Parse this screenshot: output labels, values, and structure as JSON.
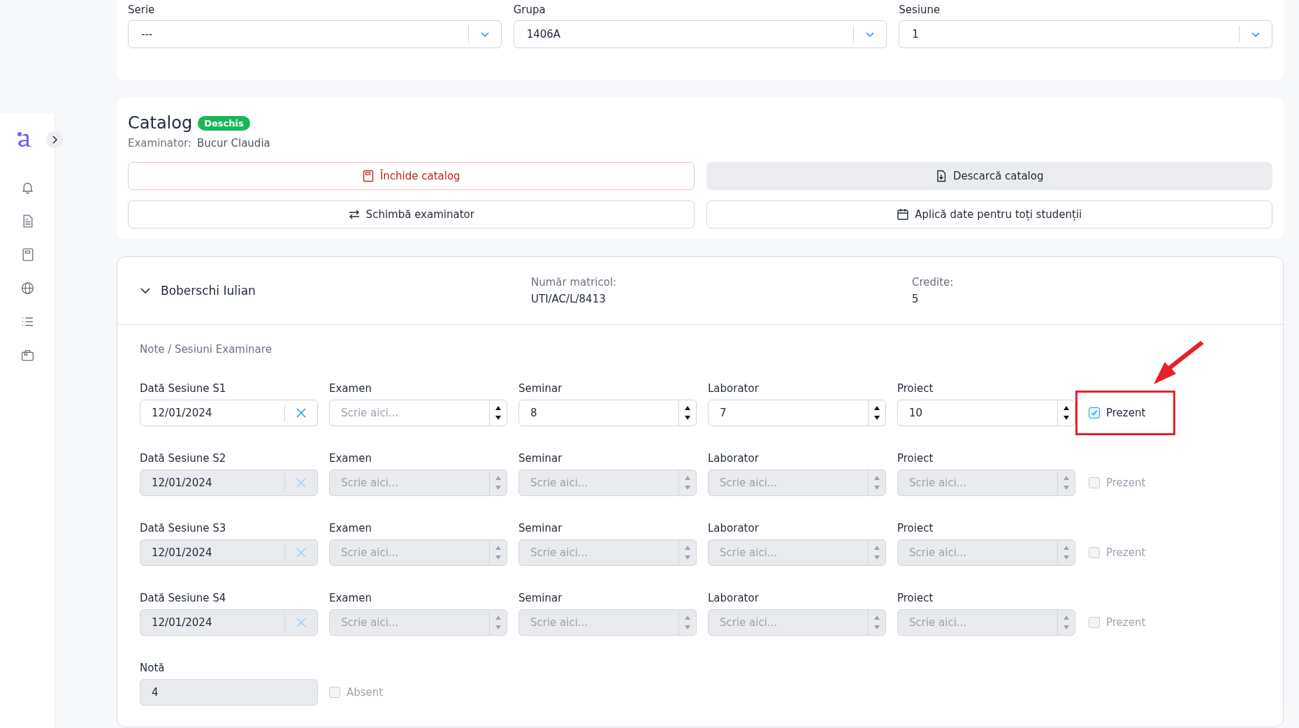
{
  "filters": [
    {
      "label": "Serie",
      "value": "---"
    },
    {
      "label": "Grupa",
      "value": "1406A"
    },
    {
      "label": "Sesiune",
      "value": "1"
    }
  ],
  "catalog": {
    "title": "Catalog",
    "status": "Deschis",
    "examiner_label": "Examinator:",
    "examiner": "Bucur Claudia",
    "buttons": [
      {
        "label": "Închide catalog",
        "kind": "danger"
      },
      {
        "label": "Descarcă catalog",
        "kind": "filled"
      },
      {
        "label": "Schimbă examinator",
        "kind": "outline"
      },
      {
        "label": "Aplică date pentru toți studenții",
        "kind": "outline"
      }
    ]
  },
  "student": {
    "name": "Boberschi Iulian",
    "expanded": true,
    "fields": [
      {
        "label": "Număr matricol:",
        "value": "UTI/AC/L/8413"
      },
      {
        "label": "Credite:",
        "value": "5"
      }
    ],
    "section_title": "Note / Sesiuni Examinare",
    "sessions": [
      {
        "date_label": "Dată Sesiune S1",
        "date": "12/01/2024",
        "disabled": false,
        "highlighted": true,
        "grades": [
          {
            "label": "Examen",
            "placeholder": "Scrie aici..."
          },
          {
            "label": "Seminar",
            "value": "8"
          },
          {
            "label": "Laborator",
            "value": "7"
          },
          {
            "label": "Proiect",
            "value": "10"
          }
        ],
        "present": {
          "label": "Prezent",
          "checked": true
        }
      },
      {
        "date_label": "Dată Sesiune S2",
        "date": "12/01/2024",
        "disabled": true,
        "highlighted": false,
        "grades": [
          {
            "label": "Examen",
            "placeholder": "Scrie aici..."
          },
          {
            "label": "Seminar",
            "placeholder": "Scrie aici..."
          },
          {
            "label": "Laborator",
            "placeholder": "Scrie aici..."
          },
          {
            "label": "Proiect",
            "placeholder": "Scrie aici..."
          }
        ],
        "present": {
          "label": "Prezent",
          "checked": false
        }
      },
      {
        "date_label": "Dată Sesiune S3",
        "date": "12/01/2024",
        "disabled": true,
        "highlighted": false,
        "grades": [
          {
            "label": "Examen",
            "placeholder": "Scrie aici..."
          },
          {
            "label": "Seminar",
            "placeholder": "Scrie aici..."
          },
          {
            "label": "Laborator",
            "placeholder": "Scrie aici..."
          },
          {
            "label": "Proiect",
            "placeholder": "Scrie aici..."
          }
        ],
        "present": {
          "label": "Prezent",
          "checked": false
        }
      },
      {
        "date_label": "Dată Sesiune S4",
        "date": "12/01/2024",
        "disabled": true,
        "highlighted": false,
        "grades": [
          {
            "label": "Examen",
            "placeholder": "Scrie aici..."
          },
          {
            "label": "Seminar",
            "placeholder": "Scrie aici..."
          },
          {
            "label": "Laborator",
            "placeholder": "Scrie aici..."
          },
          {
            "label": "Proiect",
            "placeholder": "Scrie aici..."
          }
        ],
        "present": {
          "label": "Prezent",
          "checked": false
        }
      }
    ],
    "final": {
      "label": "Notă",
      "value": "4",
      "disabled": true,
      "absent": {
        "label": "Absent",
        "checked": false,
        "disabled": true
      }
    }
  }
}
